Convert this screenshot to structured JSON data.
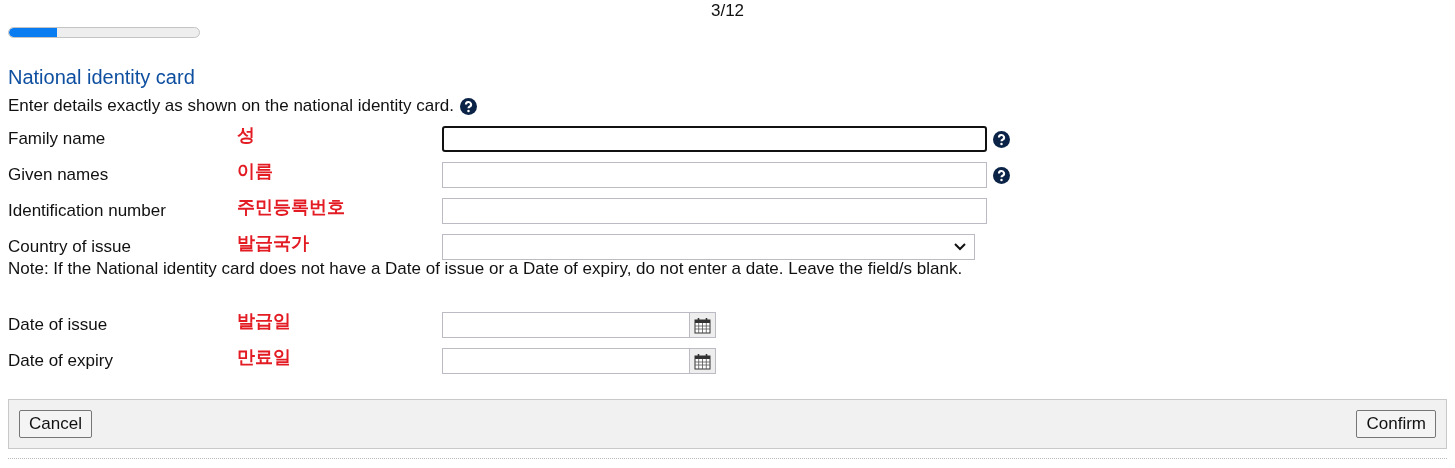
{
  "progress": {
    "step": "3/12",
    "level": 0.25
  },
  "section": {
    "title": "National identity card",
    "intro": "Enter details exactly as shown on the national identity card.",
    "intro_help": true
  },
  "fields": [
    {
      "label": "Family name",
      "note": "성",
      "kind": "text",
      "focused": true,
      "help": true
    },
    {
      "label": "Given names",
      "note": "이름",
      "kind": "text",
      "focused": false,
      "help": true
    },
    {
      "label": "Identification number",
      "note": "주민등록번호",
      "kind": "text",
      "focused": false,
      "help": false
    },
    {
      "label": "Country of issue",
      "note": "발급국가",
      "kind": "select",
      "focused": false,
      "help": false
    }
  ],
  "date_note": "Note: If the National identity card does not have a Date of issue or a Date of expiry, do not enter a date. Leave the field/s blank.",
  "date_fields": [
    {
      "label": "Date of issue",
      "note": "발급일",
      "kind": "date",
      "focused": false,
      "help": false
    },
    {
      "label": "Date of expiry",
      "note": "만료일",
      "kind": "date",
      "focused": false,
      "help": false
    }
  ],
  "buttons": {
    "cancel": "Cancel",
    "confirm": "Confirm"
  }
}
